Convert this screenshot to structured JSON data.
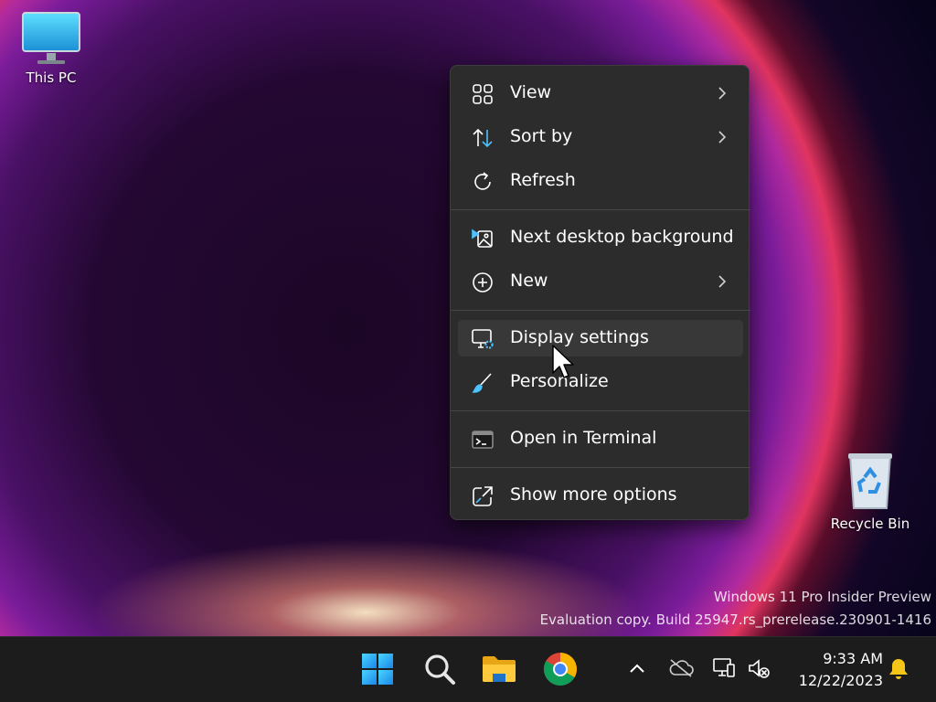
{
  "desktop": {
    "icons": [
      {
        "label": "This PC",
        "icon": "monitor-icon"
      },
      {
        "label": "Recycle Bin",
        "icon": "recycle-bin-icon"
      }
    ],
    "watermark": {
      "line1": "Windows 11 Pro Insider Preview",
      "line2": "Evaluation copy. Build 25947.rs_prerelease.230901-1416"
    }
  },
  "context_menu": {
    "items": [
      {
        "label": "View",
        "icon": "grid-icon",
        "submenu": true
      },
      {
        "label": "Sort by",
        "icon": "sort-icon",
        "submenu": true
      },
      {
        "label": "Refresh",
        "icon": "refresh-icon",
        "submenu": false
      },
      {
        "label": "Next desktop background",
        "icon": "next-background-icon",
        "submenu": false
      },
      {
        "label": "New",
        "icon": "plus-circle-icon",
        "submenu": true
      },
      {
        "label": "Display settings",
        "icon": "display-settings-icon",
        "submenu": false,
        "hovered": true
      },
      {
        "label": "Personalize",
        "icon": "brush-icon",
        "submenu": false
      },
      {
        "label": "Open in Terminal",
        "icon": "terminal-icon",
        "submenu": false
      },
      {
        "label": "Show more options",
        "icon": "share-icon",
        "submenu": false
      }
    ]
  },
  "taskbar": {
    "pinned": [
      {
        "name": "Start",
        "icon": "windows-logo-icon"
      },
      {
        "name": "Search",
        "icon": "search-icon"
      },
      {
        "name": "File Explorer",
        "icon": "folder-icon"
      },
      {
        "name": "Google Chrome",
        "icon": "chrome-icon"
      }
    ],
    "tray": [
      "chevron-up-icon",
      "onedrive-offline-icon",
      "network-icon",
      "speaker-muted-icon"
    ],
    "clock": {
      "time": "9:33 AM",
      "date": "12/22/2023"
    },
    "notification_icon": "bell-icon"
  },
  "colors": {
    "menu_background": "#2c2c2c",
    "menu_hover": "#383838",
    "taskbar": "#1c1c1c",
    "accent": "#4cc2ff",
    "text": "#ffffff"
  }
}
